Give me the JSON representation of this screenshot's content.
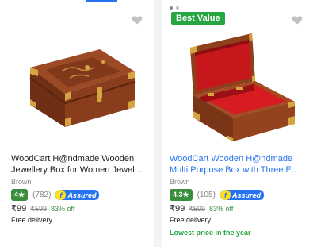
{
  "products": [
    {
      "title": "WoodCart H@ndmade Wooden Jewellery Box for Women Jewel ...",
      "brand": "Brown",
      "rating": "4★",
      "reviews": "(782)",
      "assured_label": "Assured",
      "price": "₹99",
      "mrp": "₹599",
      "discount": "83% off",
      "delivery": "Free delivery",
      "wishlist_icon": "heart-icon"
    },
    {
      "badge": "Best Value",
      "title": "WoodCart Wooden H@ndmade Multi Purpose Box with Three E...",
      "brand": "Brown",
      "rating": "4.3★",
      "reviews": "(105)",
      "assured_label": "Assured",
      "price": "₹99",
      "mrp": "₹599",
      "discount": "83% off",
      "delivery": "Free delivery",
      "highlight": "Lowest price in the year",
      "wishlist_icon": "heart-icon"
    }
  ],
  "colors": {
    "accent": "#2874f0",
    "rating_green": "#388e3c",
    "badge_green": "#26a541"
  }
}
